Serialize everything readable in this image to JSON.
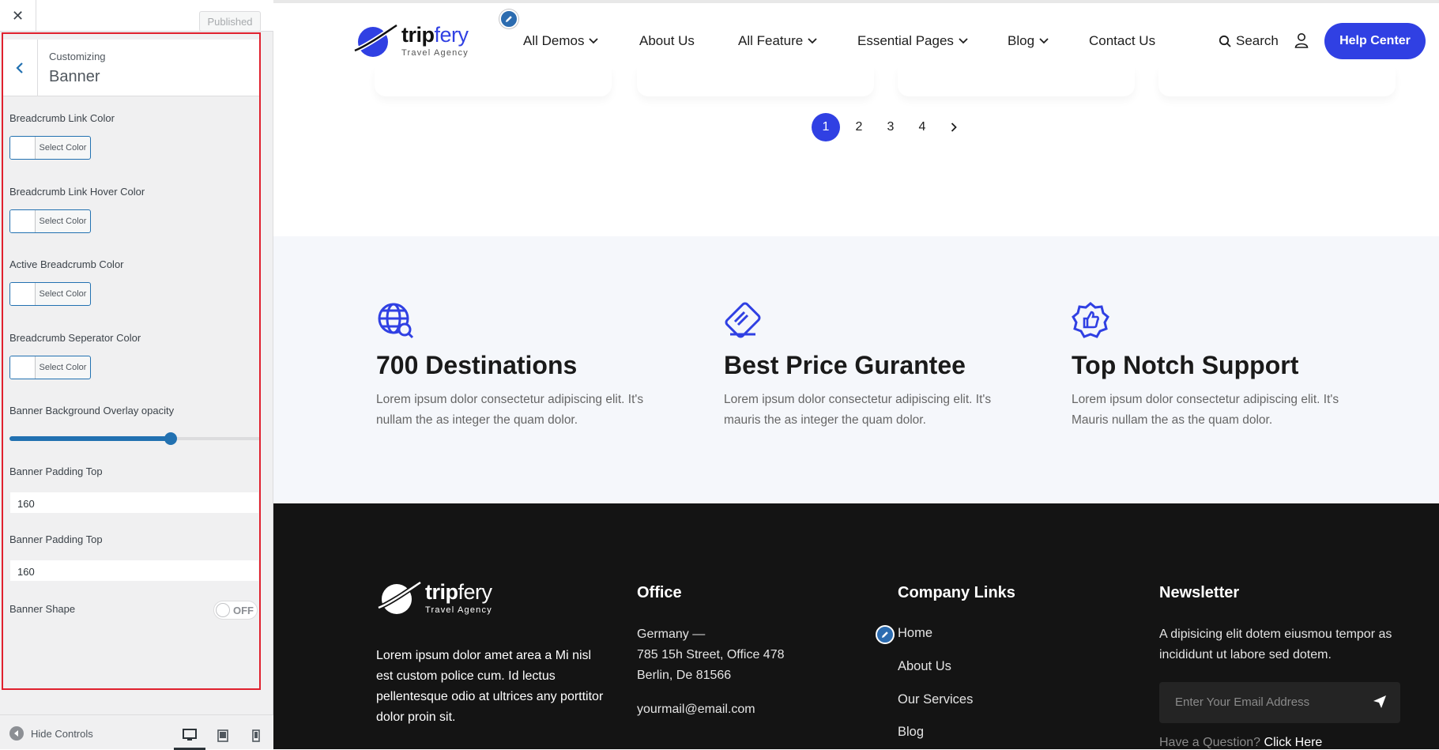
{
  "customizer": {
    "close_symbol": "✕",
    "publish_label": "Published",
    "crumb": "Customizing",
    "section_title": "Banner",
    "controls": {
      "link_color_label": "Breadcrumb Link Color",
      "link_hover_label": "Breadcrumb Link Hover Color",
      "active_label": "Active Breadcrumb Color",
      "separator_label": "Breadcrumb Seperator Color",
      "select_color": "Select Color",
      "overlay_label": "Banner Background Overlay opacity",
      "overlay_value": 0.64,
      "padding_top_label": "Banner Padding Top",
      "padding_top_value": "160",
      "padding_top2_label": "Banner Padding Top",
      "padding_top2_value": "160",
      "shape_label": "Banner Shape",
      "shape_toggle": "OFF"
    },
    "footer": {
      "hide_controls": "Hide Controls",
      "devices": [
        "desktop-icon",
        "tablet-icon",
        "mobile-icon"
      ],
      "active_device": "desktop"
    }
  },
  "site": {
    "accent_color": "#3040e3",
    "logo": {
      "word_bold": "trip",
      "word_light": "fery",
      "tagline": "Travel Agency"
    },
    "nav": {
      "items": [
        "All Demos",
        "About Us",
        "All Feature",
        "Essential Pages",
        "Blog",
        "Contact Us"
      ],
      "search": "Search",
      "help_button": "Help Center"
    },
    "pagination": {
      "pages": [
        "1",
        "2",
        "3",
        "4"
      ],
      "active": "1",
      "next_icon": "chevron-right-icon"
    },
    "features": [
      {
        "icon": "globe-search-icon",
        "title": "700 Destinations",
        "text": "Lorem ipsum dolor consectetur adipiscing elit. It's nullam the as integer the quam dolor."
      },
      {
        "icon": "card-icon",
        "title": "Best Price Gurantee",
        "text": "Lorem ipsum dolor consectetur adipiscing elit. It's mauris the as integer the quam dolor."
      },
      {
        "icon": "thumbs-up-badge-icon",
        "title": "Top Notch Support",
        "text": "Lorem ipsum dolor consectetur adipiscing elit. It's Mauris nullam the as the quam dolor."
      }
    ],
    "footer": {
      "about": "Lorem ipsum dolor amet area a Mi nisl est custom police cum. Id lectus pellentesque odio at ultrices any porttitor dolor proin sit.",
      "office_title": "Office",
      "office_lines": [
        "Germany —",
        "785 15h Street, Office 478",
        "Berlin, De 81566"
      ],
      "email": "yourmail@email.com",
      "links_title": "Company Links",
      "links": [
        "Home",
        "About Us",
        "Our Services",
        "Blog"
      ],
      "newsletter_title": "Newsletter",
      "newsletter_text": "A dipisicing elit dotem eiusmou tempor as incididunt ut labore sed dotem.",
      "email_placeholder": "Enter Your Email Address",
      "question": "Have a Question?",
      "question_link": "Click Here"
    }
  }
}
